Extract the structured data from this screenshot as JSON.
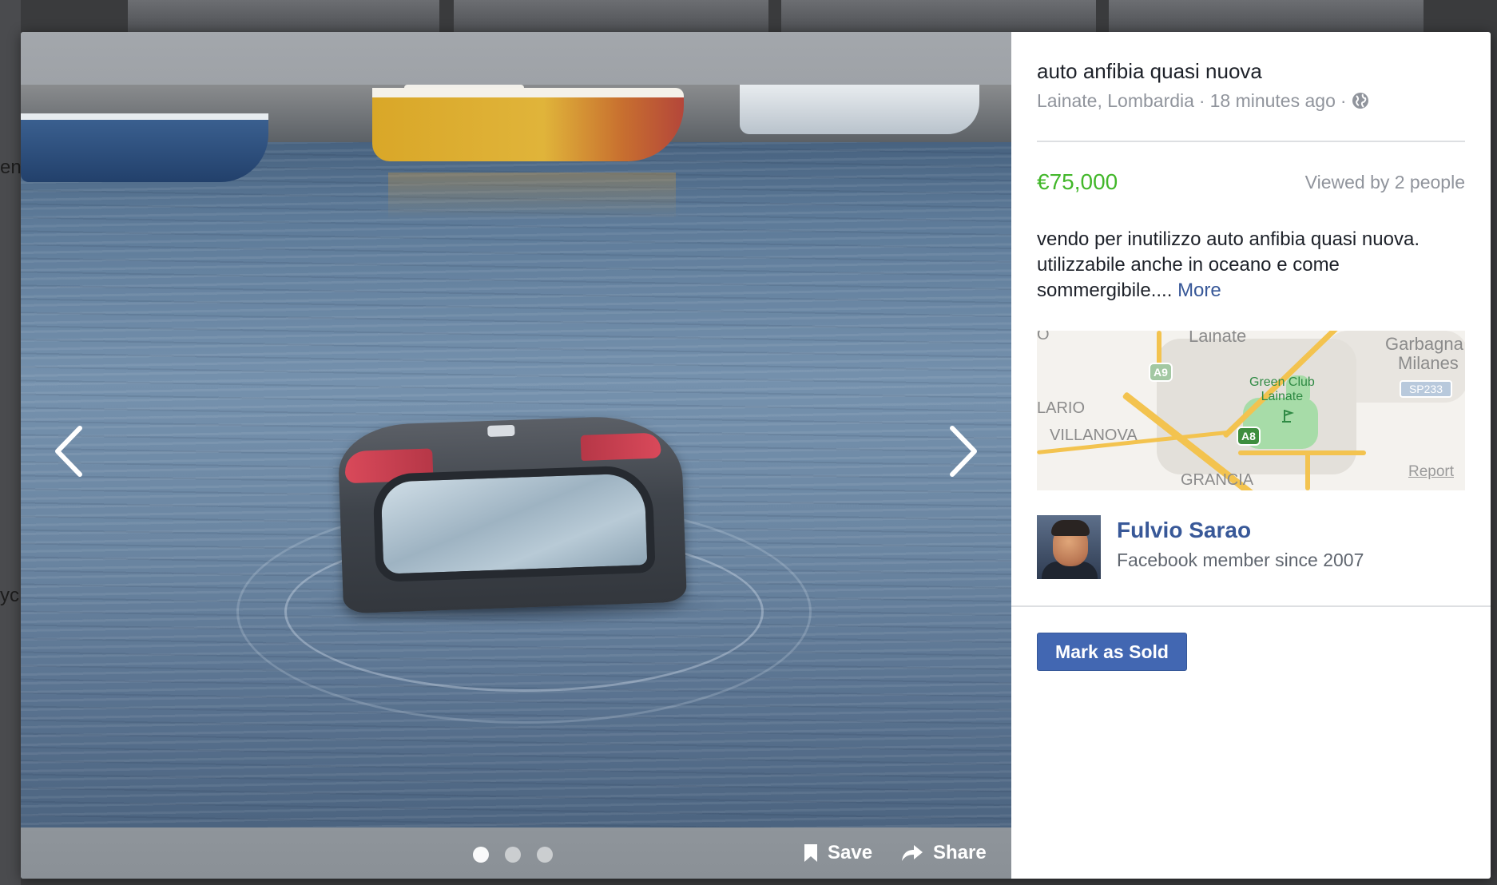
{
  "background": {
    "left_edge_text": [
      "en",
      "yc"
    ]
  },
  "viewer": {
    "photo_count": 3,
    "active_photo": 1,
    "save_label": "Save",
    "share_label": "Share",
    "prev_icon": "chevron-left-icon",
    "next_icon": "chevron-right-icon"
  },
  "listing": {
    "title": "auto anfibia quasi nuova",
    "location": "Lainate, Lombardia",
    "separator": "·",
    "time_ago": "18 minutes ago",
    "privacy_icon": "globe-icon",
    "price": "€75,000",
    "views": "Viewed by 2 people",
    "description": "vendo per inutilizzo auto anfibia quasi nuova. utilizzabile anche in oceano e come sommergibile....",
    "more_label": "More"
  },
  "map": {
    "labels": {
      "top_left": "O",
      "lainate": "Lainate",
      "garbagnate_1": "Garbagna",
      "garbagnate_2": "Milanes",
      "lario": "LARIO",
      "villanova": "VILLANOVA",
      "grancia": "GRANCIA",
      "green_club_1": "Green Club",
      "green_club_2": "Lainate"
    },
    "shields": {
      "a9": "A9",
      "a8": "A8",
      "sp233": "SP233"
    },
    "report_label": "Report"
  },
  "seller": {
    "name": "Fulvio Sarao",
    "member_since": "Facebook member since 2007"
  },
  "actions": {
    "mark_sold_label": "Mark as Sold"
  },
  "colors": {
    "price": "#42b72a",
    "link": "#385898",
    "button": "#4267b2",
    "muted": "#90949c"
  }
}
